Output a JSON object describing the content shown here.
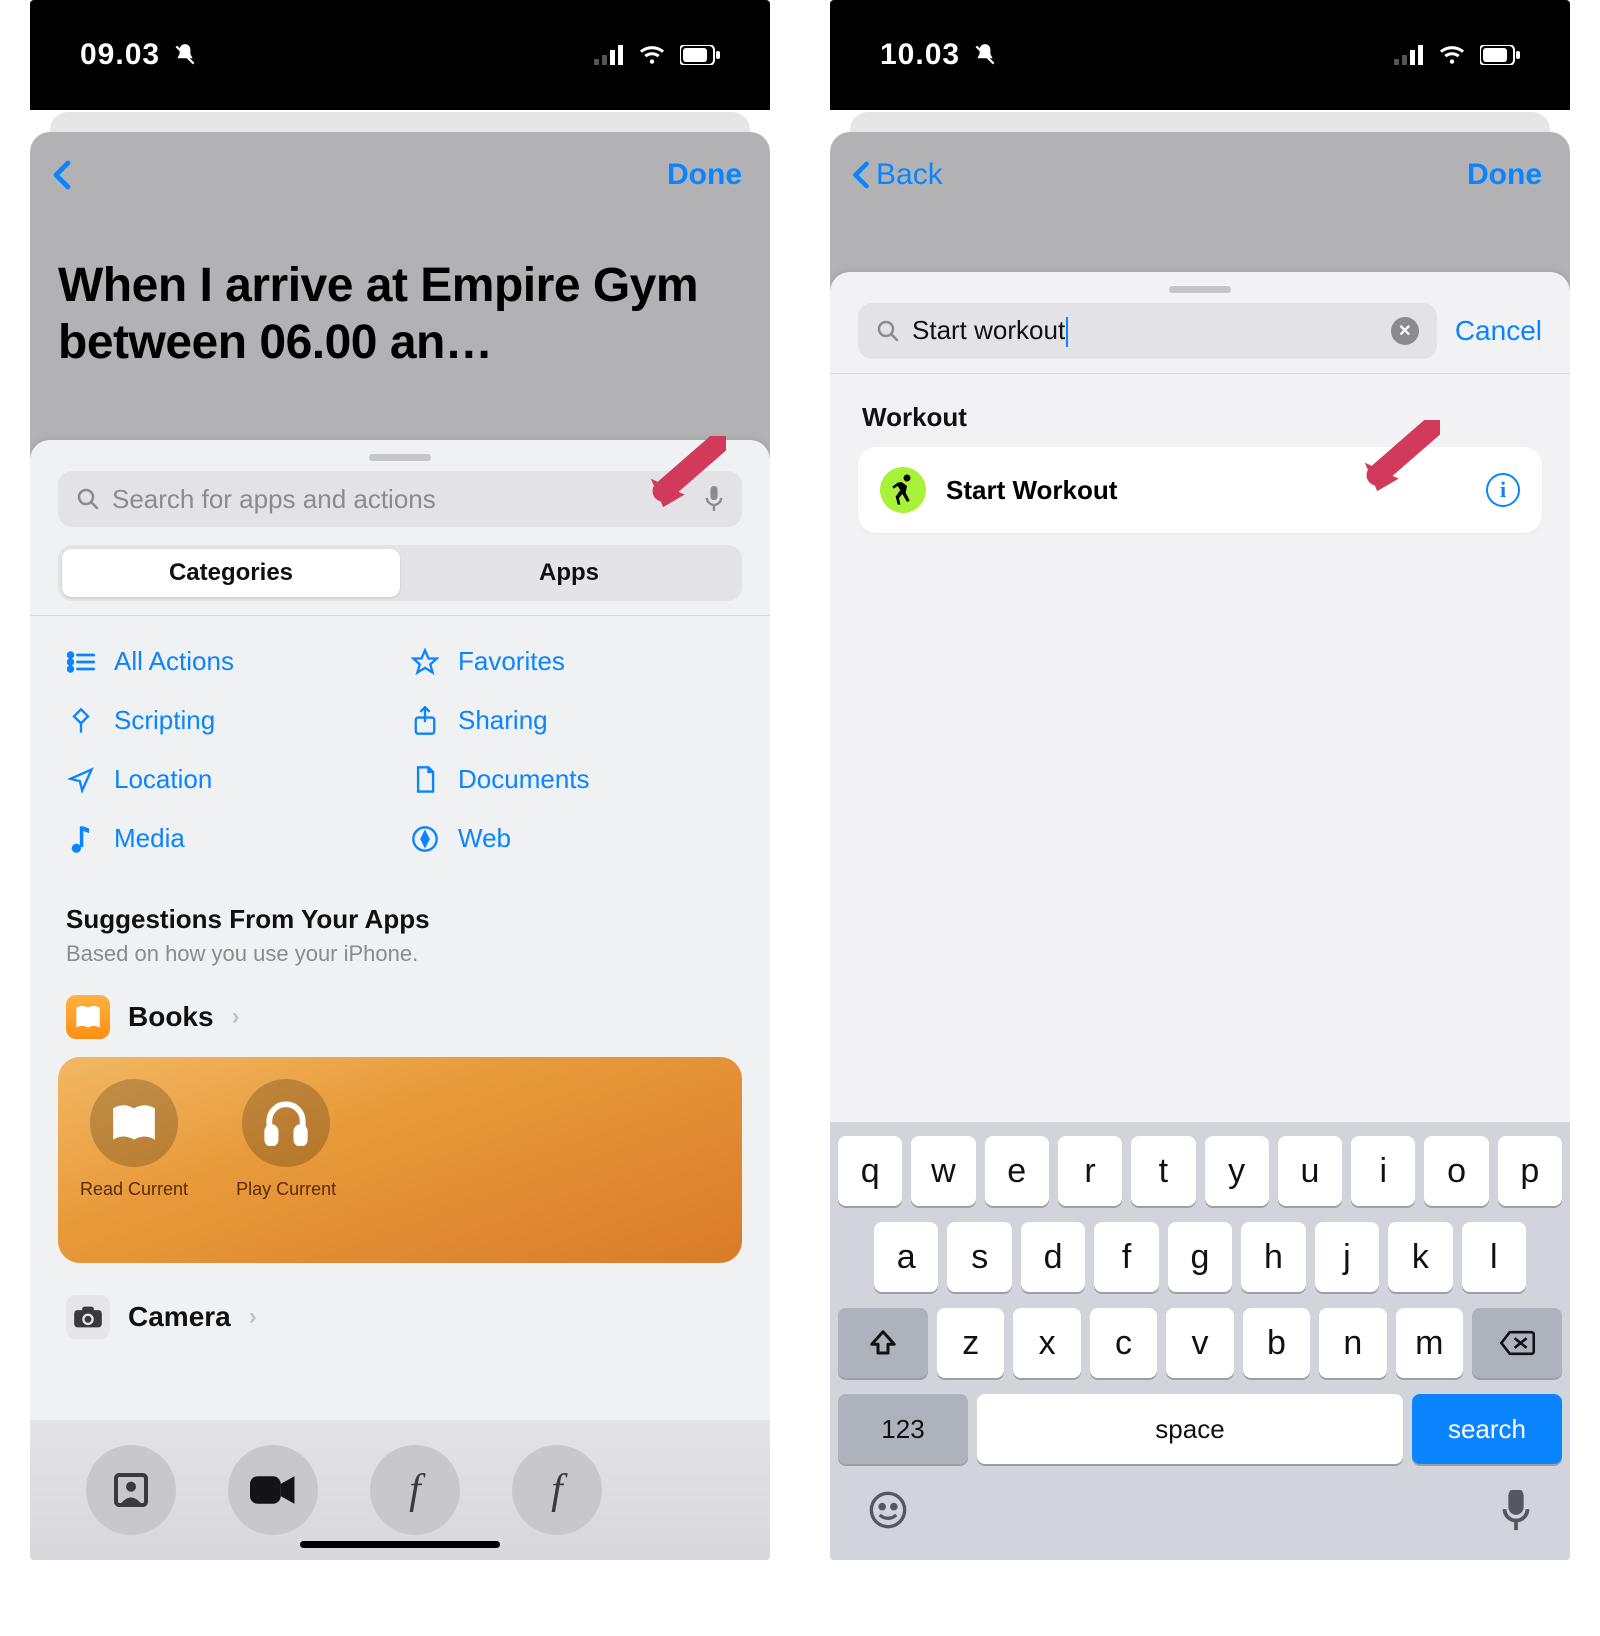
{
  "left": {
    "status_time": "09.03",
    "done_label": "Done",
    "automation_title": "When I arrive at Empire Gym between 06.00 an…",
    "search_placeholder": "Search for apps and actions",
    "tabs": {
      "categories": "Categories",
      "apps": "Apps"
    },
    "categories": [
      {
        "icon": "list",
        "label": "All Actions"
      },
      {
        "icon": "star",
        "label": "Favorites"
      },
      {
        "icon": "scripting",
        "label": "Scripting"
      },
      {
        "icon": "share",
        "label": "Sharing"
      },
      {
        "icon": "location",
        "label": "Location"
      },
      {
        "icon": "doc",
        "label": "Documents"
      },
      {
        "icon": "music",
        "label": "Media"
      },
      {
        "icon": "compass",
        "label": "Web"
      }
    ],
    "suggestions_header": "Suggestions From Your Apps",
    "suggestions_sub": "Based on how you use your iPhone.",
    "apps": {
      "books": "Books",
      "camera": "Camera"
    },
    "books_actions": {
      "read": "Read Current",
      "play": "Play Current"
    }
  },
  "right": {
    "status_time": "10.03",
    "back_label": "Back",
    "done_label": "Done",
    "search_value": "Start workout",
    "cancel_label": "Cancel",
    "result_section": "Workout",
    "result_item": "Start Workout",
    "keyboard": {
      "rows": [
        [
          "q",
          "w",
          "e",
          "r",
          "t",
          "y",
          "u",
          "i",
          "o",
          "p"
        ],
        [
          "a",
          "s",
          "d",
          "f",
          "g",
          "h",
          "j",
          "k",
          "l"
        ],
        [
          "z",
          "x",
          "c",
          "v",
          "b",
          "n",
          "m"
        ]
      ],
      "num": "123",
      "space": "space",
      "search": "search"
    }
  }
}
